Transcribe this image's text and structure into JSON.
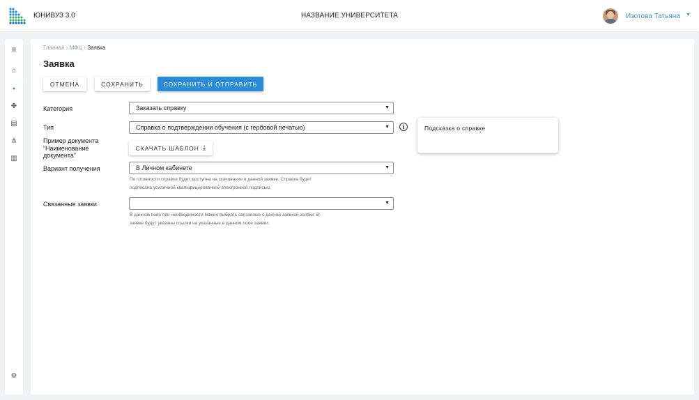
{
  "header": {
    "app_name": "ЮНИВУЗ 3.0",
    "university_name": "НАЗВАНИЕ УНИВЕРСИТЕТА",
    "user_name": "Изотова Татьяна",
    "user_caret": "▼"
  },
  "sidebar": {
    "items": [
      {
        "icon": "menu-icon",
        "glyph": "≡"
      },
      {
        "icon": "home-icon",
        "glyph": "⌂"
      },
      {
        "icon": "user-icon",
        "glyph": "●"
      },
      {
        "icon": "puzzle-icon",
        "glyph": "✤"
      },
      {
        "icon": "document-icon",
        "glyph": "▤"
      },
      {
        "icon": "hierarchy-icon",
        "glyph": "⋔"
      },
      {
        "icon": "chart-icon",
        "glyph": "▥"
      }
    ],
    "settings_glyph": "⚙"
  },
  "breadcrumb": {
    "home": "Главная",
    "sep1": "›",
    "mfc": "МФЦ",
    "sep2": "›",
    "current": "Заявка"
  },
  "page_title": "Заявка",
  "buttons": {
    "cancel": "ОТМЕНА",
    "save": "СОХРАНИТЬ",
    "save_send": "СОХРАНИТЬ И ОТПРАВИТЬ",
    "download_template": "СКАЧАТЬ ШАБЛОН",
    "download_glyph": "⤓"
  },
  "form": {
    "category_label": "Категория",
    "category_value": "Заказать справку",
    "type_label": "Тип",
    "type_value": "Справка о подтверждении обучения (с гербовой печатью)",
    "example_label_1": "Пример документа",
    "example_label_2": "“Наименование",
    "example_label_3": "документа”",
    "delivery_label": "Вариант получения",
    "delivery_value": "В Личном кабинете",
    "delivery_hint_1": "По готовности справка будет доступна на скачивание в данной заявке. Справка будет",
    "delivery_hint_2": "подписана усиленной квалифицированной электронной подписью.",
    "related_label": "Связанные заявки",
    "related_value": "",
    "related_hint_1": "В данном поле при необходимости можно выбрать связанные с данной заявкой заявки. В",
    "related_hint_2": "заявке будут указаны ссылки на указанные в данном поле заявки.",
    "caret": "▼",
    "info_glyph": "i"
  },
  "tooltip": {
    "text": "Подсказка о справке"
  },
  "colors": {
    "accent": "#2a8cd6",
    "link": "#3c8fd1",
    "background": "#f1f2f4"
  }
}
